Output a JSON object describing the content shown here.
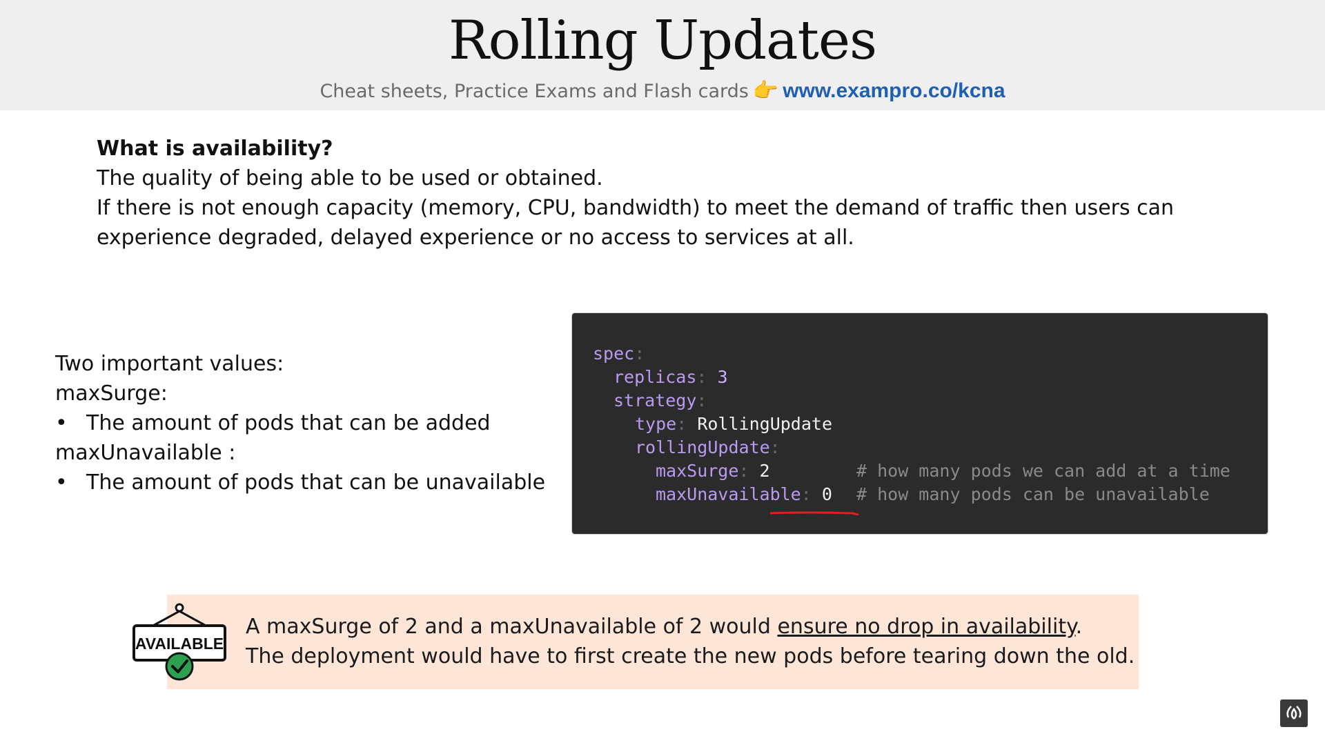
{
  "header": {
    "title": "Rolling Updates",
    "subtitle": "Cheat sheets, Practice Exams and Flash cards",
    "hand_icon": "👉",
    "link": "www.exampro.co/kcna"
  },
  "intro": {
    "question": "What is availability?",
    "line1": "The quality of being able to be used or obtained.",
    "line2": "If there is not enough capacity (memory, CPU, bandwidth) to meet the demand of traffic then users can",
    "line3": "experience degraded, delayed experience or no access to services at all."
  },
  "values": {
    "heading": "Two important values:",
    "surge_label": "maxSurge:",
    "surge_desc": "The amount of pods that can be added",
    "unavail_label": "maxUnavailable :",
    "unavail_desc": "The amount of pods that can be unavailable",
    "bullet": "•"
  },
  "code": {
    "spec": "spec",
    "replicas_key": "replicas",
    "replicas_val": "3",
    "strategy": "strategy",
    "type_key": "type",
    "type_val": "RollingUpdate",
    "rolling": "rollingUpdate",
    "surge_key": "maxSurge",
    "surge_val": "2",
    "surge_comment": "# how many pods we can add at a time",
    "unavail_key": "maxUnavailable",
    "unavail_val": "0",
    "unavail_comment": "# how many pods can be unavailable",
    "colon": ":"
  },
  "callout": {
    "sign_text": "AVAILABLE",
    "line1_pre": "A maxSurge of 2 and a maxUnavailable of 2 would ",
    "line1_underlined": "ensure no drop in availability",
    "line1_post": ".",
    "line2": "The deployment would have to first create the new pods before tearing down the old."
  },
  "colors": {
    "header_bg": "#efefef",
    "link": "#1f5fb0",
    "code_bg": "#2b2b2b",
    "code_key": "#b99bf0",
    "callout_bg": "#fde5d7",
    "check_green": "#2e9e4f",
    "annotation_red": "#e02020"
  }
}
